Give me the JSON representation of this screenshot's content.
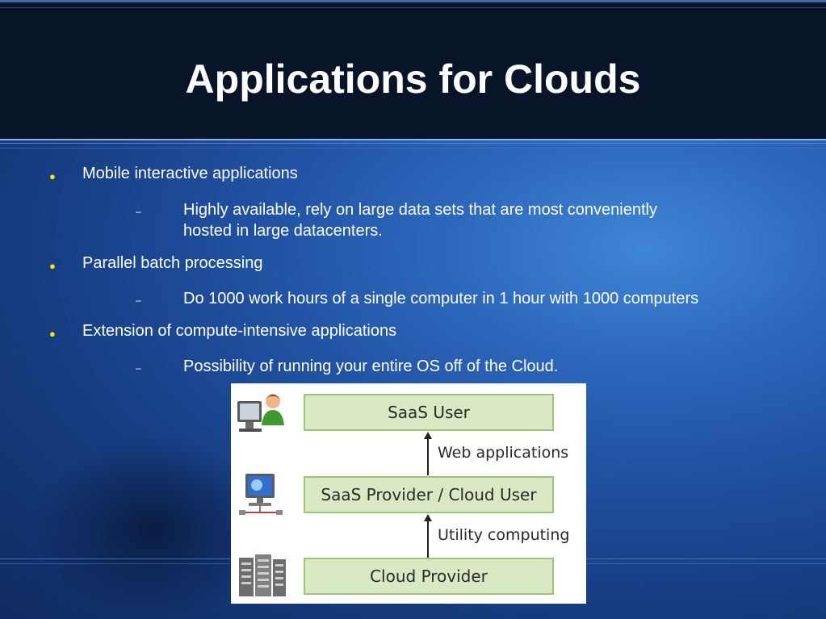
{
  "title": "Applications for Clouds",
  "colors": {
    "bullet": "#ffe400",
    "title_bar": "#081427",
    "background": "#1f4f9f",
    "box_fill": "#d9e9c3",
    "box_border": "#9fc27a"
  },
  "bullets": [
    {
      "text": "Mobile interactive applications",
      "sub": [
        "Highly available, rely on large data sets that are most conveniently",
        "hosted in large datacenters."
      ]
    },
    {
      "text": "Parallel batch processing",
      "sub": [
        "Do 1000 work hours of a single computer in 1 hour with 1000 computers"
      ]
    },
    {
      "text": "Extension of compute-intensive applications",
      "sub": [
        "Possibility of running your entire OS off of the Cloud."
      ]
    }
  ],
  "diagram": {
    "layers": [
      "SaaS User",
      "SaaS Provider / Cloud User",
      "Cloud Provider"
    ],
    "links": [
      "Web applications",
      "Utility computing"
    ],
    "icons": [
      "user-at-computer-icon",
      "networked-computer-icon",
      "server-rack-icon"
    ]
  }
}
